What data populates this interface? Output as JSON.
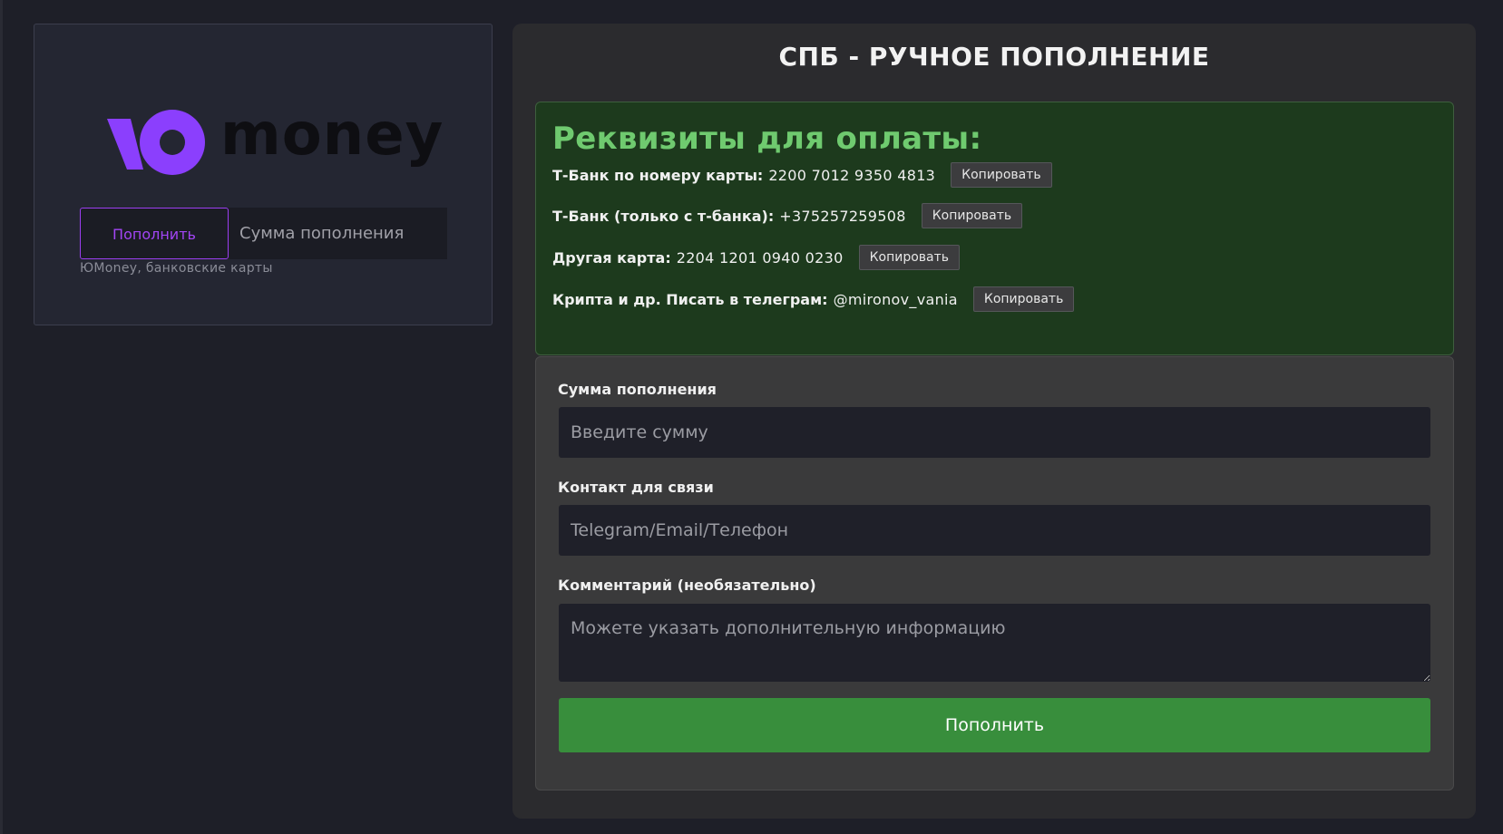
{
  "yoomoney": {
    "logo_text": "money",
    "submit_label": "Пополнить",
    "amount_placeholder": "Сумма пополнения",
    "note": "ЮMoney, банковские карты",
    "brand_color": "#8b3ffd"
  },
  "sbp": {
    "title": "СПБ - РУЧНОЕ ПОПОЛНЕНИЕ",
    "requisites_title": "Реквизиты для оплаты:",
    "requisites": [
      {
        "label": "Т-Банк по номеру карты:",
        "value": "2200 7012 9350 4813",
        "copy_label": "Копировать"
      },
      {
        "label": "Т-Банк (только с т-банка):",
        "value": "+375257259508",
        "copy_label": "Копировать"
      },
      {
        "label": "Другая карта:",
        "value": "2204 1201 0940 0230",
        "copy_label": "Копировать"
      },
      {
        "label": "Крипта и др. Писать в телеграм:",
        "value": "@mironov_vania",
        "copy_label": "Копировать"
      }
    ],
    "form": {
      "amount_label": "Сумма пополнения",
      "amount_placeholder": "Введите сумму",
      "contact_label": "Контакт для связи",
      "contact_placeholder": "Telegram/Email/Телефон",
      "comment_label": "Комментарий (необязательно)",
      "comment_placeholder": "Можете указать дополнительную информацию",
      "submit_label": "Пополнить"
    },
    "colors": {
      "requisites_bg": "#1d3a1d",
      "requisites_title": "#6fca6f",
      "submit_bg": "#388e3c"
    }
  }
}
